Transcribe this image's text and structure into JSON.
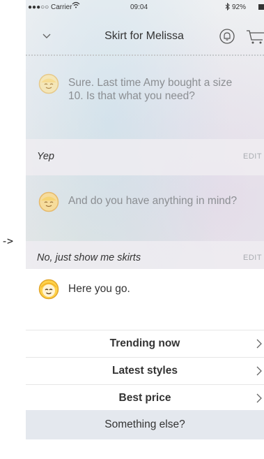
{
  "external": {
    "arrow": "->"
  },
  "status_bar": {
    "carrier": "●●●○○ Carrier",
    "time": "09:04",
    "battery": "92%"
  },
  "nav": {
    "title": "Skirt for Melissa",
    "icons": [
      "chevron-down-icon",
      "bell-icon",
      "cart-icon"
    ]
  },
  "conversation": {
    "bot_messages": [
      "Sure. Last time Amy bought a size 10. Is that what you need?",
      "And do you have anything in mind?"
    ],
    "user_replies": [
      {
        "text": "Yep",
        "edit_label": "EDIT"
      },
      {
        "text": "No, just show me skirts",
        "edit_label": "EDIT"
      }
    ]
  },
  "results_card": {
    "message": "Here you go.",
    "options": [
      "Trending now",
      "Latest styles",
      "Best price"
    ],
    "other_option": "Something else?"
  },
  "colors": {
    "avatar_fill": "#ffd24a",
    "avatar_stroke": "#e2a62a",
    "text_dark": "#333333",
    "text_muted": "#8b8e92",
    "edit_text": "#a9acb1"
  }
}
